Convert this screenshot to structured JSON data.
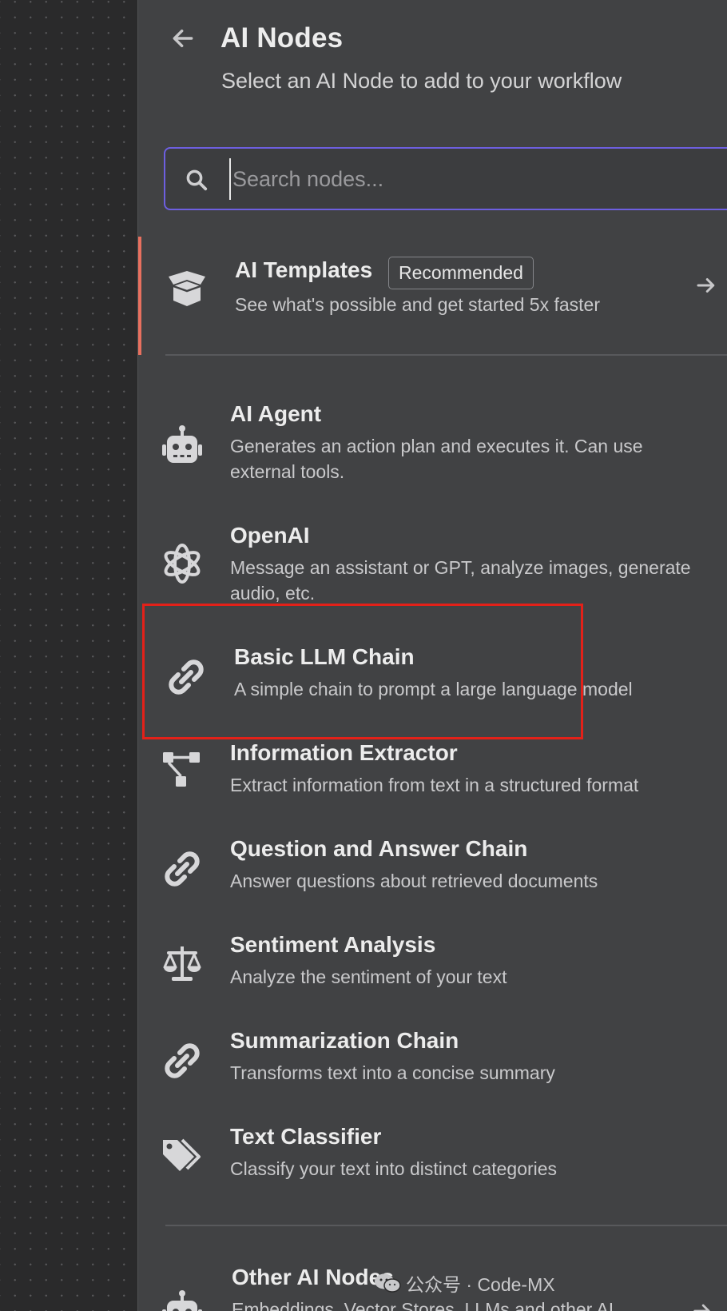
{
  "header": {
    "back_icon": "arrow-left-icon",
    "title": "AI Nodes",
    "subtitle": "Select an AI Node to add to your workflow"
  },
  "search": {
    "icon": "search-icon",
    "value": "",
    "placeholder": "Search nodes..."
  },
  "templates": {
    "icon": "box-icon",
    "name": "AI Templates",
    "badge": "Recommended",
    "description": "See what's possible and get started 5x faster",
    "arrow_icon": "arrow-right-icon",
    "accent_color": "#e8705f"
  },
  "nodes": [
    {
      "name": "AI Agent",
      "description": "Generates an action plan and executes it. Can use external tools.",
      "icon": "robot-icon"
    },
    {
      "name": "OpenAI",
      "description": "Message an assistant or GPT, analyze images, generate audio, etc.",
      "icon": "openai-icon"
    },
    {
      "name": "Basic LLM Chain",
      "description": "A simple chain to prompt a large language model",
      "icon": "link-icon"
    },
    {
      "name": "Information Extractor",
      "description": "Extract information from text in a structured format",
      "icon": "hierarchy-icon"
    },
    {
      "name": "Question and Answer Chain",
      "description": "Answer questions about retrieved documents",
      "icon": "link-icon"
    },
    {
      "name": "Sentiment Analysis",
      "description": "Analyze the sentiment of your text",
      "icon": "balance-scale-icon"
    },
    {
      "name": "Summarization Chain",
      "description": "Transforms text into a concise summary",
      "icon": "link-icon"
    },
    {
      "name": "Text Classifier",
      "description": "Classify your text into distinct categories",
      "icon": "tags-icon"
    }
  ],
  "other_nodes": {
    "name": "Other AI Nodes",
    "description": "Embeddings, Vector Stores, LLMs and other AI",
    "icon": "robot-icon",
    "arrow_icon": "arrow-right-icon"
  },
  "watermark": {
    "icon": "wechat-icon",
    "text": "公众号 · Code-MX"
  },
  "colors": {
    "panel_bg": "#414244",
    "canvas_bg": "#2a2a2b",
    "search_border": "#6d5fe0",
    "highlight_box": "#e32119"
  }
}
